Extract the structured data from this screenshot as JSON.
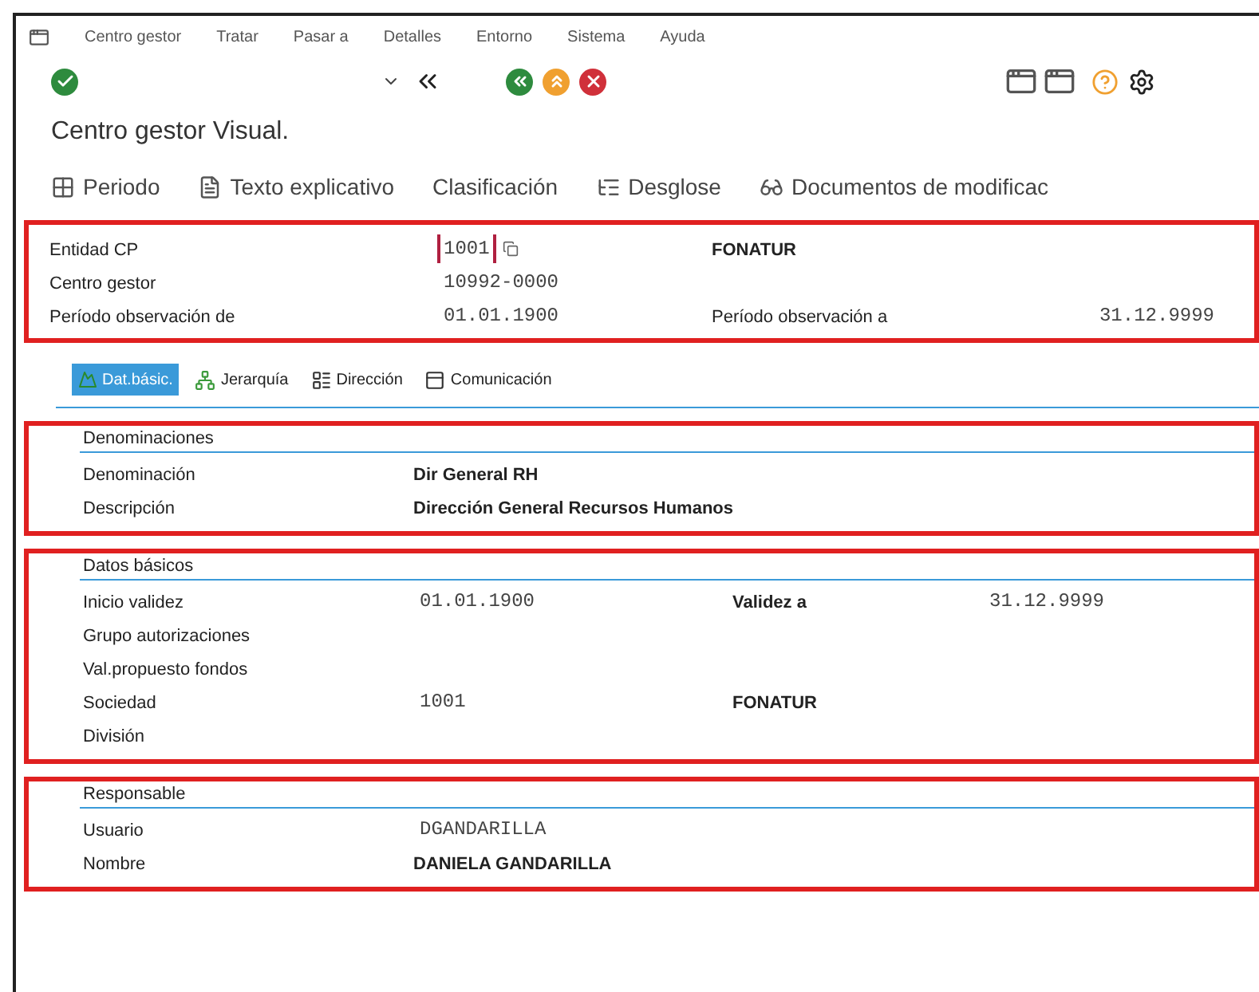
{
  "menu": [
    "Centro gestor",
    "Tratar",
    "Pasar a",
    "Detalles",
    "Entorno",
    "Sistema",
    "Ayuda"
  ],
  "title": "Centro gestor Visual.",
  "app_toolbar": [
    {
      "kind": "period",
      "label": "Periodo"
    },
    {
      "kind": "text",
      "label": "Texto explicativo"
    },
    {
      "kind": "none",
      "label": "Clasificación"
    },
    {
      "kind": "breakdown",
      "label": "Desglose"
    },
    {
      "kind": "glasses",
      "label": "Documentos de modificac"
    }
  ],
  "header": [
    {
      "cells": [
        {
          "kind": "label",
          "text": "Entidad CP"
        },
        {
          "kind": "input",
          "text": "1001",
          "focused": true
        },
        {
          "kind": "bold",
          "text": "FONATUR"
        }
      ]
    },
    {
      "cells": [
        {
          "kind": "label",
          "text": "Centro gestor"
        },
        {
          "kind": "input",
          "text": "10992-0000",
          "focused": false
        }
      ]
    },
    {
      "cells": [
        {
          "kind": "label",
          "text": "Período observación de"
        },
        {
          "kind": "input",
          "text": "01.01.1900",
          "focused": false
        },
        {
          "kind": "label",
          "text": "Período observación a"
        },
        {
          "kind": "input",
          "text": "31.12.9999",
          "focused": false
        }
      ]
    }
  ],
  "tabs": [
    {
      "kind": "basic",
      "label": "Dat.básic.",
      "selected": true
    },
    {
      "kind": "hierarchy",
      "label": "Jerarquía",
      "selected": false
    },
    {
      "kind": "address",
      "label": "Dirección",
      "selected": false
    },
    {
      "kind": "comm",
      "label": "Comunicación",
      "selected": false
    }
  ],
  "groups": [
    {
      "title": "Denominaciones",
      "rows": [
        {
          "cells": [
            {
              "kind": "label",
              "text": "Denominación"
            },
            {
              "kind": "bold",
              "text": "Dir General RH"
            }
          ]
        },
        {
          "cells": [
            {
              "kind": "label",
              "text": "Descripción"
            },
            {
              "kind": "bold",
              "text": "Dirección General Recursos Humanos"
            }
          ]
        }
      ]
    },
    {
      "title": "Datos básicos",
      "rows": [
        {
          "cells": [
            {
              "kind": "label",
              "text": "Inicio validez"
            },
            {
              "kind": "input",
              "text": "01.01.1900",
              "focused": false
            },
            {
              "kind": "bold",
              "text": "Validez a"
            },
            {
              "kind": "input",
              "text": "31.12.9999",
              "focused": false
            }
          ]
        },
        {
          "cells": [
            {
              "kind": "label",
              "text": "Grupo autorizaciones"
            }
          ]
        },
        {
          "cells": [
            {
              "kind": "label",
              "text": "Val.propuesto fondos"
            }
          ]
        },
        {
          "cells": [
            {
              "kind": "label",
              "text": "Sociedad"
            },
            {
              "kind": "input",
              "text": "1001",
              "focused": false
            },
            {
              "kind": "bold",
              "text": "FONATUR"
            }
          ]
        },
        {
          "cells": [
            {
              "kind": "label",
              "text": "División"
            }
          ]
        }
      ]
    },
    {
      "title": "Responsable",
      "rows": [
        {
          "cells": [
            {
              "kind": "label",
              "text": "Usuario"
            },
            {
              "kind": "input",
              "text": "DGANDARILLA",
              "focused": false
            }
          ]
        },
        {
          "cells": [
            {
              "kind": "label",
              "text": "Nombre"
            },
            {
              "kind": "bold",
              "text": "DANIELA GANDARILLA"
            }
          ]
        }
      ]
    }
  ]
}
